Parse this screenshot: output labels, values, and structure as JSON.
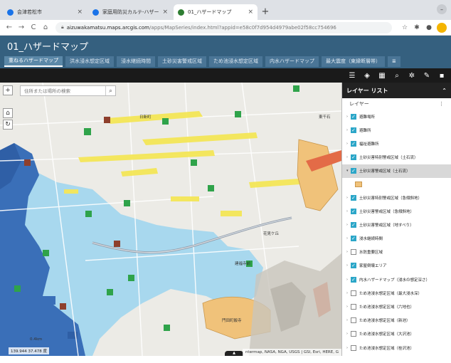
{
  "browser": {
    "tabs": [
      {
        "label": "会津若松市",
        "active": false
      },
      {
        "label": "家庭用防災カルテ-ハザードマップ |",
        "active": false
      },
      {
        "label": "01_ハザードマップ",
        "active": true
      }
    ],
    "url_host": "aizuwakamatsu.maps.arcgis.com",
    "url_path": "/apps/MapSeries/index.html?appid=e58c0f7d954d4979abe02f58cc754696"
  },
  "app": {
    "title": "01_ハザードマップ",
    "nav_tabs": [
      {
        "label": "重ねるハザードマップ",
        "active": true
      },
      {
        "label": "洪水浸水想定区域",
        "active": false
      },
      {
        "label": "浸水継続時間",
        "active": false
      },
      {
        "label": "土砂災害警戒区域",
        "active": false
      },
      {
        "label": "ため池浸水想定区域",
        "active": false
      },
      {
        "label": "内水ハザードマップ",
        "active": false
      },
      {
        "label": "最大震度（東縁断層帯）",
        "active": false
      },
      {
        "label": "≣",
        "active": false
      }
    ]
  },
  "map": {
    "search_placeholder": "住所または場所の検索",
    "coords": "139.944 37.478 度",
    "attribution": "ntermap, NASA, NGA, USGS | GSI, Esri, HERE, G",
    "places": {
      "p1": "日新町",
      "p2": "花見ケ丘",
      "p3": "門田町飯寺",
      "p4": "建福寺前",
      "p5": "東千石",
      "p6": "0.4km"
    }
  },
  "layer_panel": {
    "title": "レイヤー リスト",
    "subtitle": "レイヤー",
    "items": [
      {
        "label": "避難場所",
        "checked": true,
        "selected": false
      },
      {
        "label": "避難所",
        "checked": true,
        "selected": false
      },
      {
        "label": "福祉避難所",
        "checked": true,
        "selected": false
      },
      {
        "label": "土砂災害特別警戒区域（土石流）",
        "checked": true,
        "selected": false
      },
      {
        "label": "土砂災害警戒区域（土石流）",
        "checked": true,
        "selected": true
      },
      {
        "label": "土砂災害特別警戒区域（急傾斜地）",
        "checked": true,
        "selected": false
      },
      {
        "label": "土砂災害警戒区域（急傾斜地）",
        "checked": true,
        "selected": false
      },
      {
        "label": "土砂災害警戒区域（地すべり）",
        "checked": true,
        "selected": false
      },
      {
        "label": "浸水継続時間",
        "checked": true,
        "selected": false
      },
      {
        "label": "水防重要区域",
        "checked": false,
        "selected": false
      },
      {
        "label": "家屋倒壊エリア",
        "checked": true,
        "selected": false
      },
      {
        "label": "内水ハザードマップ（浸水の想定深さ）",
        "checked": true,
        "selected": false
      },
      {
        "label": "ため池浸水想定区域（最大浸水深）",
        "checked": false,
        "selected": false
      },
      {
        "label": "ため池浸水想定区域（六地也）",
        "checked": false,
        "selected": false
      },
      {
        "label": "ため池浸水想定区域（新池）",
        "checked": false,
        "selected": false
      },
      {
        "label": "ため池浸水想定区域（大沢池）",
        "checked": false,
        "selected": false
      },
      {
        "label": "ため池浸水想定区域（桂沢池）",
        "checked": false,
        "selected": false
      }
    ]
  },
  "colors": {
    "header": "#35607f",
    "flood_dark": "#3a6fb8",
    "flood_light": "#a8d8ee",
    "checkbox": "#2ba6c8"
  }
}
